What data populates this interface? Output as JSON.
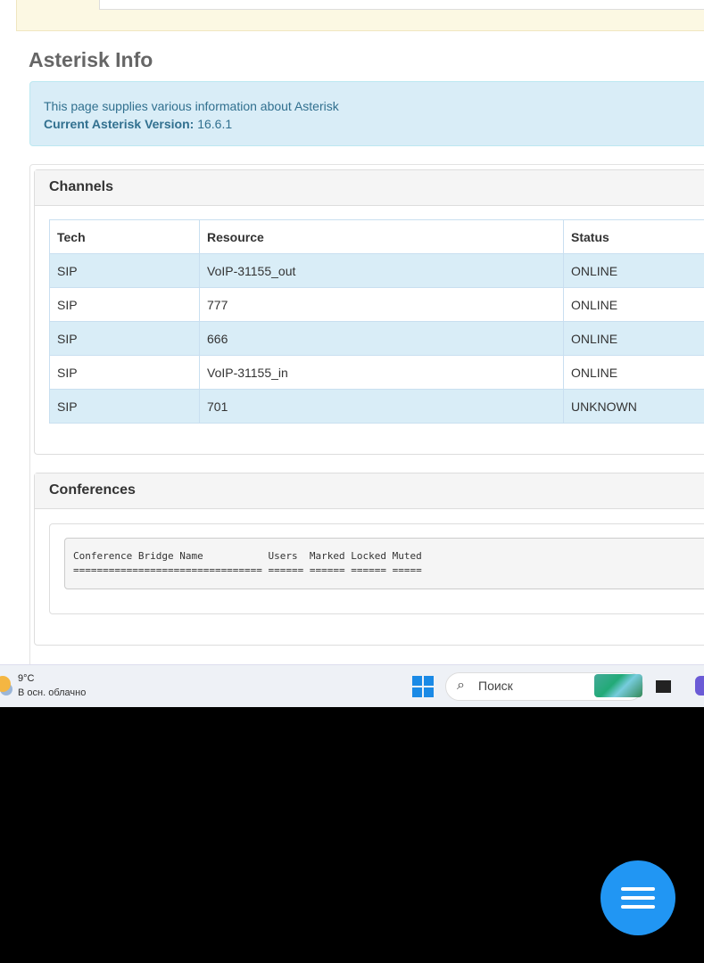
{
  "page": {
    "title": "Asterisk Info"
  },
  "info": {
    "description": "This page supplies various information about Asterisk",
    "version_label": "Current Asterisk Version:",
    "version": "16.6.1"
  },
  "channels": {
    "title": "Channels",
    "columns": [
      "Tech",
      "Resource",
      "Status"
    ],
    "rows": [
      [
        "SIP",
        "VoIP-31155_out",
        "ONLINE"
      ],
      [
        "SIP",
        "777",
        "ONLINE"
      ],
      [
        "SIP",
        "666",
        "ONLINE"
      ],
      [
        "SIP",
        "VoIP-31155_in",
        "ONLINE"
      ],
      [
        "SIP",
        "701",
        "UNKNOWN"
      ]
    ]
  },
  "conferences": {
    "title": "Conferences",
    "output": "Conference Bridge Name           Users  Marked Locked Muted\n================================ ====== ====== ====== ====="
  },
  "taskbar": {
    "temperature": "9°C",
    "condition": "В осн. облачно",
    "search_placeholder": "Поиск"
  }
}
